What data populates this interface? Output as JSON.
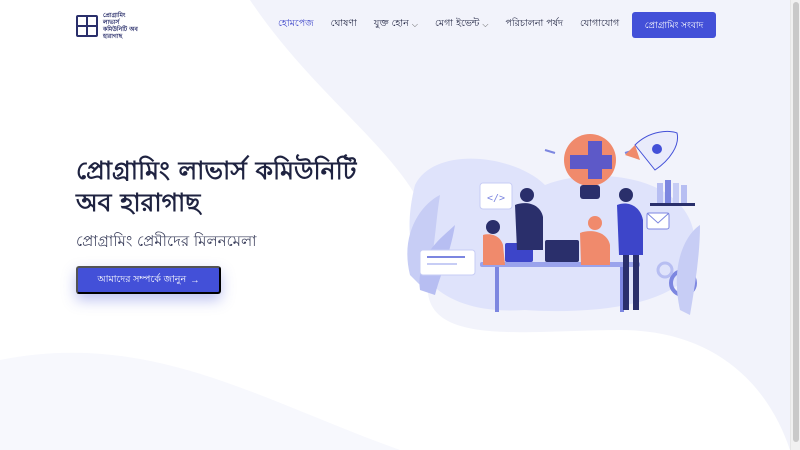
{
  "logo": {
    "icon": "puzzle-grid-logo-icon",
    "line1": "প্রোগ্রামিং লাভার্স",
    "line2": "কমিউনিটি অব",
    "line3": "হারাগাছ"
  },
  "nav": {
    "items": [
      {
        "label": "হোমপেজ",
        "active": true
      },
      {
        "label": "ঘোষণা"
      },
      {
        "label": "যুক্ত হোন",
        "dropdown": true
      },
      {
        "label": "মেগা ইভেন্ট",
        "dropdown": true
      },
      {
        "label": "পরিচালনা পর্ষদ"
      },
      {
        "label": "যোগাযোগ"
      }
    ],
    "cta": "প্রোগ্রামিং সংবাদ"
  },
  "hero": {
    "title_line1": "প্রোগ্রামিং লাভার্স কমিউনিটি",
    "title_line2": "অব হারাগাছ",
    "subtitle": "প্রোগ্রামিং প্রেমীদের মিলনমেলা",
    "button": "আমাদের সম্পর্কে জানুন",
    "button_icon": "arrow-right-icon"
  },
  "colors": {
    "accent": "#4350d8",
    "heading": "#1f2341",
    "wave": "#eef0fa"
  }
}
